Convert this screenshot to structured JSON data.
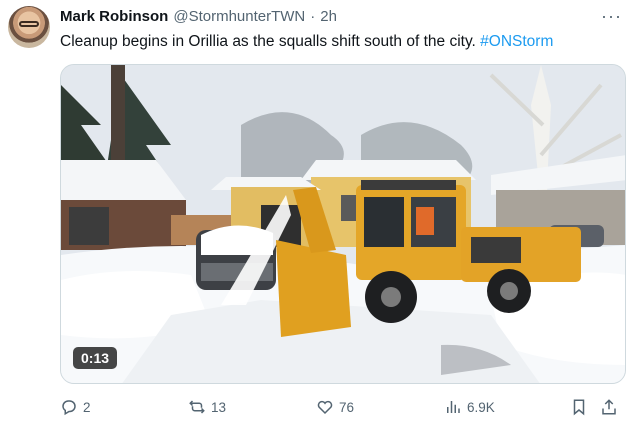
{
  "tweet": {
    "author_name": "Mark Robinson",
    "handle": "@StormhunterTWN",
    "separator": "·",
    "time": "2h",
    "text": "Cleanup begins in Orillia as the squalls shift south of the city.",
    "hashtag": "#ONStorm",
    "more_icon": "more-icon"
  },
  "media": {
    "duration": "0:13"
  },
  "actions": {
    "replies": "2",
    "retweets": "13",
    "likes": "76",
    "views": "6.9K"
  },
  "colors": {
    "link": "#1d9bf0",
    "secondary_text": "#536471",
    "primary_text": "#0f1419",
    "plow": "#e0a020"
  }
}
